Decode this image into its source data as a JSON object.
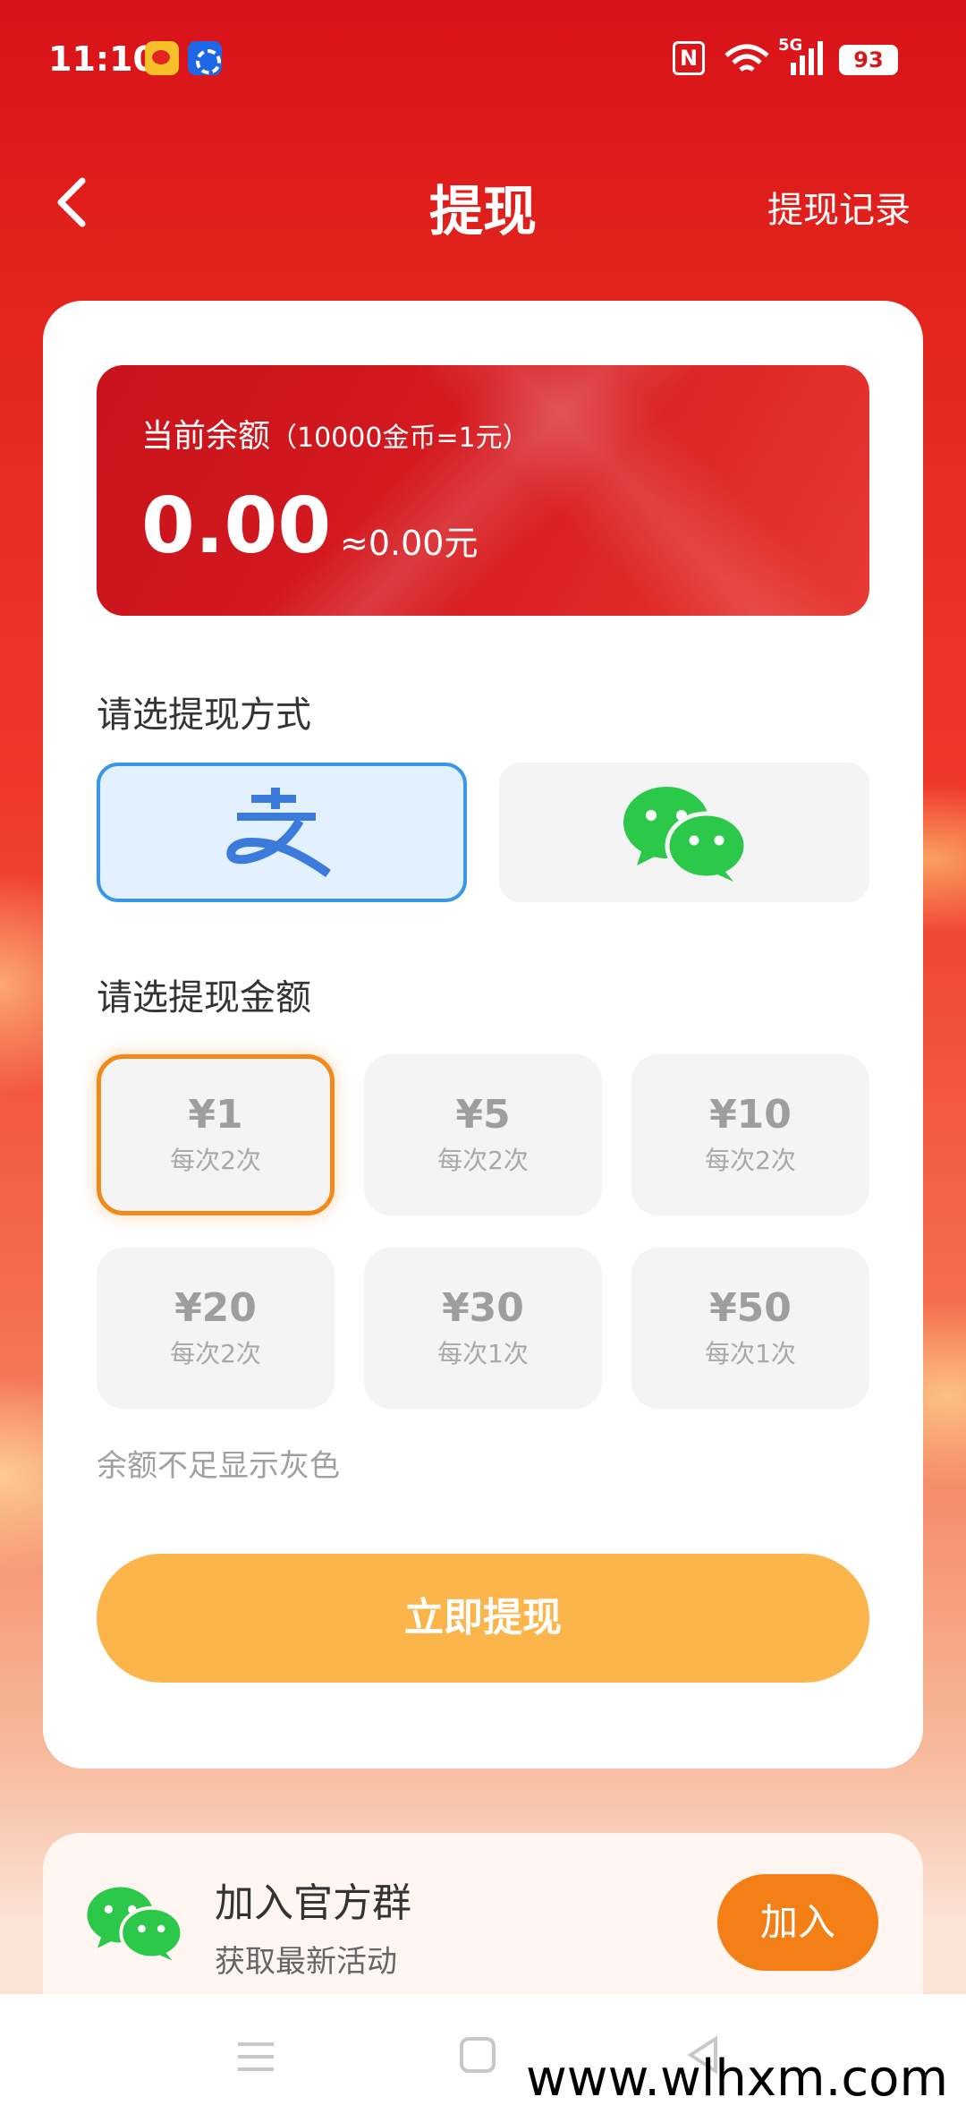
{
  "status_bar": {
    "time": "11:10",
    "network": "5G",
    "battery": "93"
  },
  "header": {
    "title": "提现",
    "record_link": "提现记录"
  },
  "balance": {
    "label": "当前余额",
    "rate_hint": "（10000金币=1元）",
    "amount": "0.00",
    "approx": "≈0.00元"
  },
  "payment": {
    "section_title": "请选提现方式",
    "methods": [
      {
        "icon": "alipay-icon",
        "selected": true
      },
      {
        "icon": "wechat-icon",
        "selected": false
      }
    ]
  },
  "amounts": {
    "section_title": "请选提现金额",
    "options": [
      {
        "value": "¥1",
        "limit": "每次2次",
        "selected": true
      },
      {
        "value": "¥5",
        "limit": "每次2次",
        "selected": false
      },
      {
        "value": "¥10",
        "limit": "每次2次",
        "selected": false
      },
      {
        "value": "¥20",
        "limit": "每次2次",
        "selected": false
      },
      {
        "value": "¥30",
        "limit": "每次1次",
        "selected": false
      },
      {
        "value": "¥50",
        "limit": "每次1次",
        "selected": false
      }
    ],
    "note": "余额不足显示灰色"
  },
  "submit_label": "立即提现",
  "group": {
    "title": "加入官方群",
    "subtitle": "获取最新活动",
    "join_label": "加入"
  },
  "watermark": "www.wlhxm.com",
  "colors": {
    "primary_red": "#d8121a",
    "alipay_blue": "#3a96e6",
    "wechat_green": "#2bc84a",
    "selected_orange": "#f18a1b",
    "submit_yellow": "#fcb54a",
    "join_orange": "#f47f16"
  }
}
